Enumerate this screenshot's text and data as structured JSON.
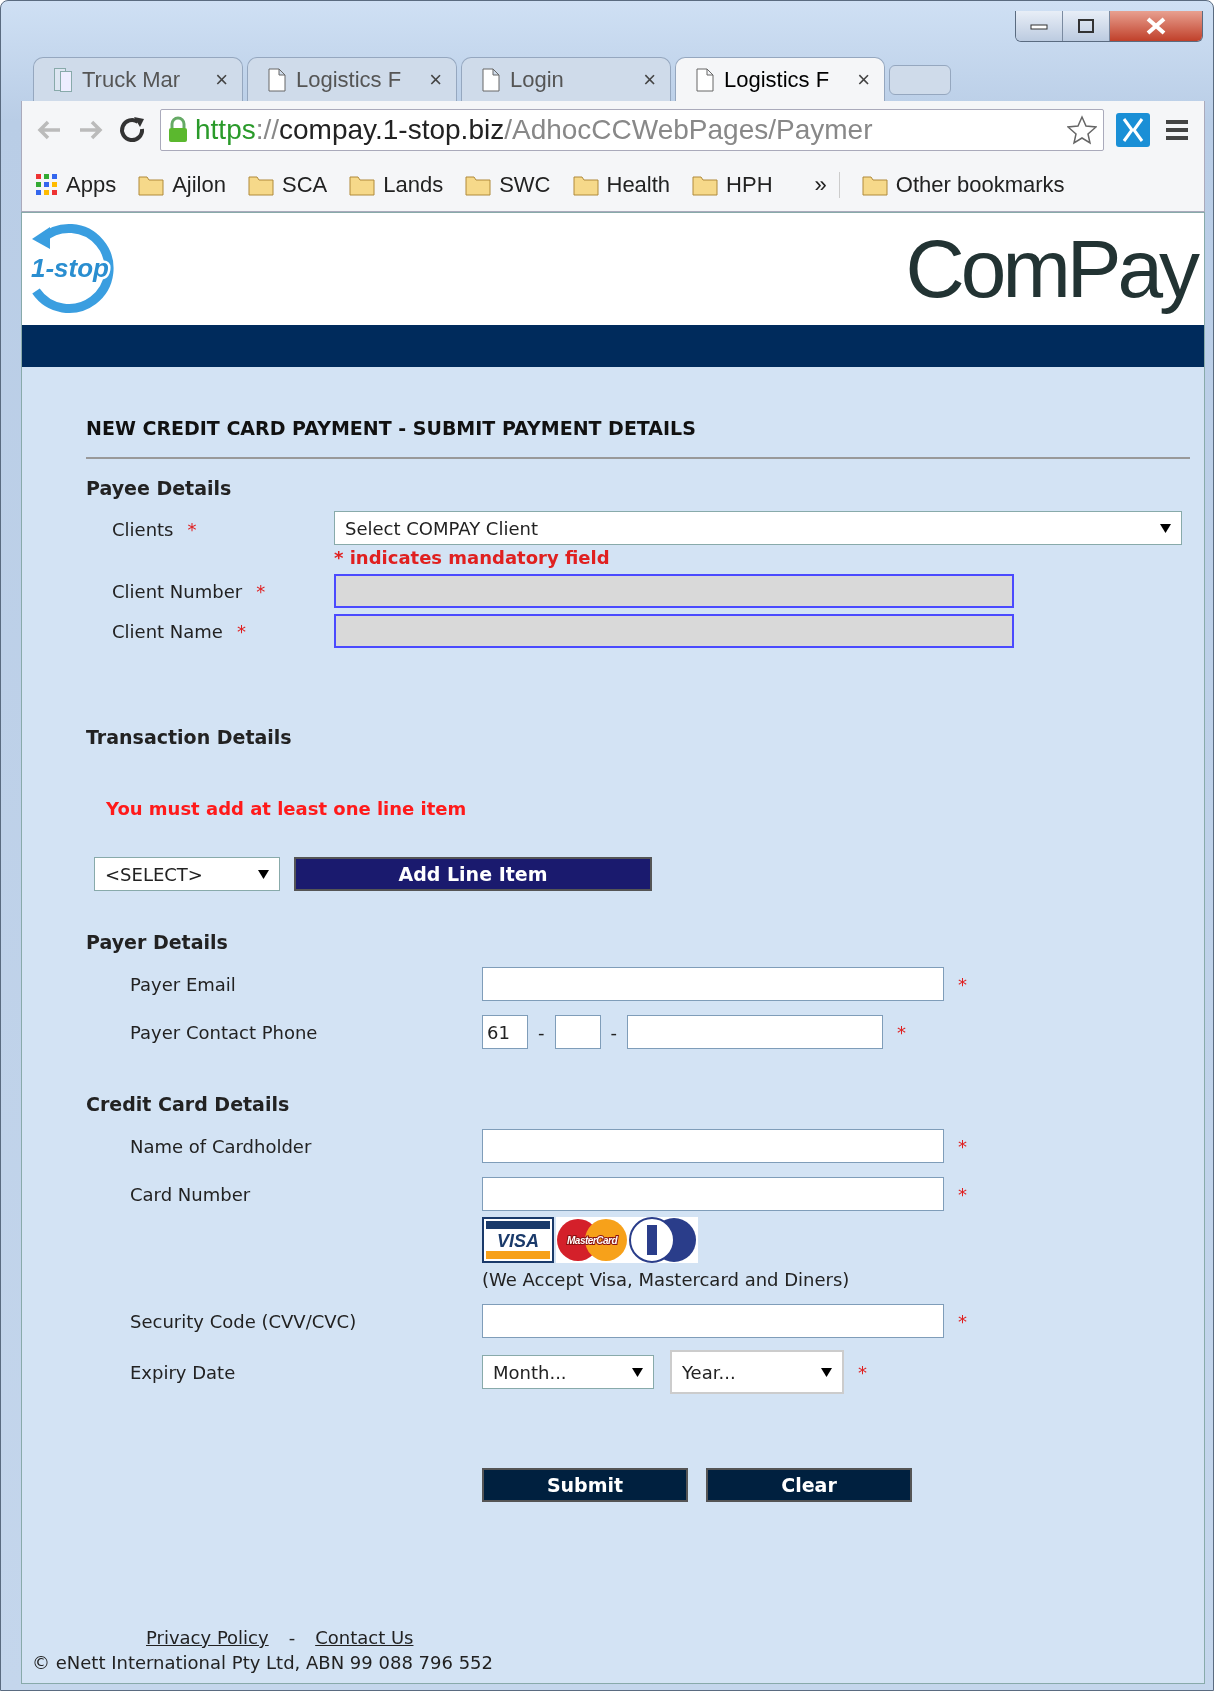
{
  "tabs": [
    {
      "title": "Truck Mar",
      "close": "×",
      "selected": false
    },
    {
      "title": "Logistics F",
      "close": "×",
      "selected": false
    },
    {
      "title": "Login",
      "close": "×",
      "selected": false
    },
    {
      "title": "Logistics F",
      "close": "×",
      "selected": true
    }
  ],
  "toolbar": {
    "secure": true,
    "url": {
      "scheme": "https",
      "separator": "://",
      "host": "compay.1-stop.biz",
      "path": "/AdhocCCWebPages/Paymer"
    }
  },
  "bookmarks": {
    "items": [
      {
        "label": "Apps",
        "kind": "apps"
      },
      {
        "label": "Ajilon",
        "kind": "folder"
      },
      {
        "label": "SCA",
        "kind": "folder"
      },
      {
        "label": "Lands",
        "kind": "folder"
      },
      {
        "label": "SWC",
        "kind": "folder"
      },
      {
        "label": "Health",
        "kind": "folder"
      },
      {
        "label": "HPH",
        "kind": "folder"
      }
    ],
    "overflow": "»",
    "other": "Other bookmarks"
  },
  "header": {
    "logo": "1-stop",
    "brand": "ComPay"
  },
  "heading": "NEW CREDIT CARD PAYMENT - SUBMIT PAYMENT DETAILS",
  "payee": {
    "title": "Payee Details",
    "clients": {
      "label": "Clients",
      "marker": "*",
      "value": "Select COMPAY Client"
    },
    "note": "* indicates mandatory field",
    "fields": [
      {
        "label": "Client Number",
        "marker": "*",
        "disabled": true
      },
      {
        "label": "Client Name",
        "marker": "*",
        "disabled": true
      }
    ]
  },
  "transaction": {
    "title": "Transaction Details",
    "error": "You must add at least one line item",
    "select": "<SELECT>",
    "button": "Add Line Item"
  },
  "payer": {
    "title": "Payer Details",
    "email": {
      "label": "Payer Email",
      "marker": "*"
    },
    "phone": {
      "label": "Payer Contact Phone",
      "country": "61",
      "dash_1": "-",
      "dash_2": "-",
      "marker": "*"
    }
  },
  "card": {
    "title": "Credit Card Details",
    "holder": {
      "label": "Name of Cardholder",
      "marker": "*"
    },
    "number": {
      "label": "Card Number",
      "marker": "*"
    },
    "logos": {
      "visa": "VISA",
      "mastercard": "MasterCard"
    },
    "accepted": "(We Accept Visa, Mastercard and Diners)",
    "security": {
      "label": "Security Code (CVV/CVC)",
      "marker": "*"
    },
    "expiry": {
      "label": "Expiry Date",
      "month": "Month...",
      "year": "Year...",
      "marker": "*"
    }
  },
  "actions": [
    "Submit",
    "Clear"
  ],
  "footer": {
    "links": [
      "Privacy Policy",
      "Contact Us"
    ],
    "separator": "-",
    "copyright": "© eNett International Pty Ltd, ABN 99 088 796 552"
  }
}
